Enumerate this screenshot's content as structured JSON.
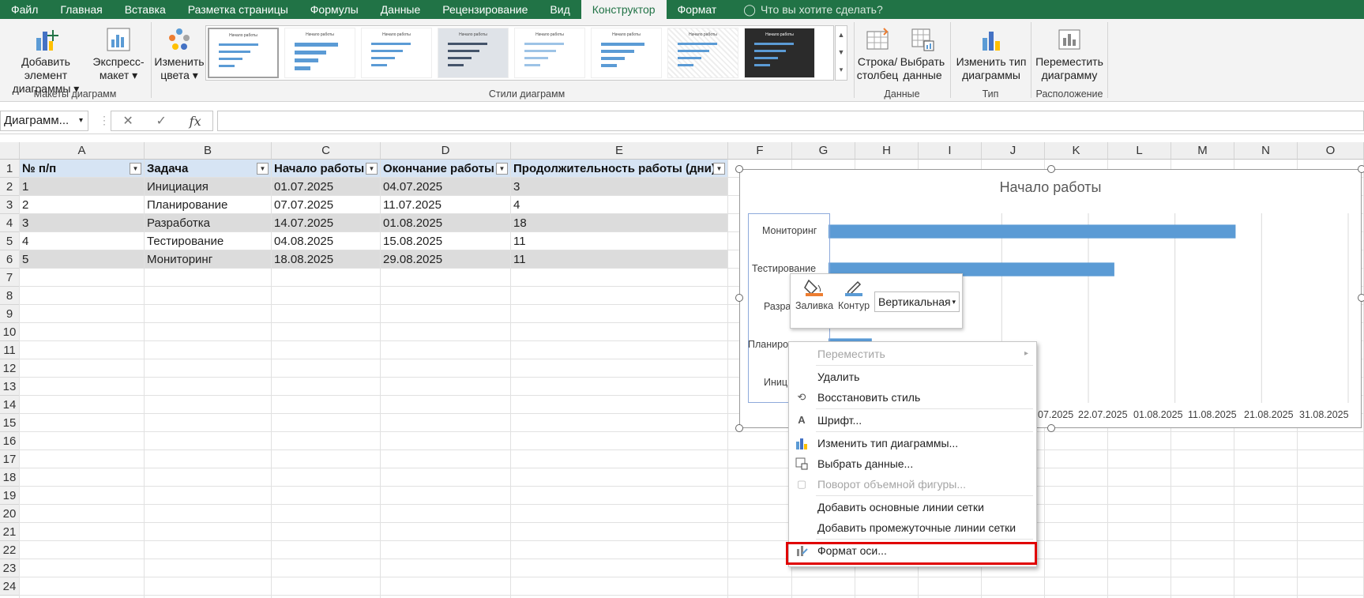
{
  "tabs": [
    "Файл",
    "Главная",
    "Вставка",
    "Разметка страницы",
    "Формулы",
    "Данные",
    "Рецензирование",
    "Вид",
    "Конструктор",
    "Формат"
  ],
  "active_tab": "Конструктор",
  "search_placeholder": "Что вы хотите сделать?",
  "ribbon": {
    "add_element": "Добавить элемент диаграммы",
    "express_layout": "Экспресс-макет",
    "change_colors": "Изменить цвета",
    "group_layouts": "Макеты диаграмм",
    "group_styles": "Стили диаграмм",
    "row_col": "Строка/ столбец",
    "select_data": "Выбрать данные",
    "group_data": "Данные",
    "change_type": "Изменить тип диаграммы",
    "group_type": "Тип",
    "move_chart": "Переместить диаграмму",
    "group_location": "Расположение",
    "style_thumb_title": "Начало работы"
  },
  "formula_bar": {
    "name_box": "Диаграмм...",
    "fx": "fx",
    "value": ""
  },
  "columns": [
    "A",
    "B",
    "C",
    "D",
    "E",
    "F",
    "G",
    "H",
    "I",
    "J",
    "K",
    "L",
    "M",
    "N",
    "O"
  ],
  "rows": [
    "1",
    "2",
    "3",
    "4",
    "5",
    "6",
    "7",
    "8",
    "9",
    "10",
    "11",
    "12",
    "13",
    "14",
    "15",
    "16",
    "17",
    "18",
    "19",
    "20",
    "21",
    "22",
    "23",
    "24"
  ],
  "table": {
    "headers": [
      "№ п/п",
      "Задача",
      "Начало работы",
      "Окончание работы",
      "Продолжительность работы (дни)"
    ],
    "rows": [
      [
        "1",
        "Инициация",
        "01.07.2025",
        "04.07.2025",
        "3"
      ],
      [
        "2",
        "Планирование",
        "07.07.2025",
        "11.07.2025",
        "4"
      ],
      [
        "3",
        "Разработка",
        "14.07.2025",
        "01.08.2025",
        "18"
      ],
      [
        "4",
        "Тестирование",
        "04.08.2025",
        "15.08.2025",
        "11"
      ],
      [
        "5",
        "Мониторинг",
        "18.08.2025",
        "29.08.2025",
        "11"
      ]
    ]
  },
  "chart": {
    "title": "Начало работы",
    "visible_y_labels": [
      "Мониторинг",
      "Тестирование",
      "Разра",
      "Планиро",
      "Иниц"
    ],
    "x_tick_labels": [
      "07.2025",
      "22.07.2025",
      "01.08.2025",
      "11.08.2025",
      "21.08.2025",
      "31.08.2025"
    ]
  },
  "chart_data": {
    "type": "bar",
    "title": "Начало работы",
    "categories": [
      "Инициация",
      "Планирование",
      "Разработка",
      "Тестирование",
      "Мониторинг"
    ],
    "values": [
      "01.07.2025",
      "07.07.2025",
      "14.07.2025",
      "04.08.2025",
      "18.08.2025"
    ],
    "x_tick_labels": [
      "22.07.2025",
      "01.08.2025",
      "11.08.2025",
      "21.08.2025",
      "31.08.2025"
    ],
    "bar_color": "#5b9bd5"
  },
  "mini_toolbar": {
    "fill": "Заливка",
    "outline": "Контур",
    "selector": "Вертикальная"
  },
  "context_menu": {
    "move": "Переместить",
    "delete": "Удалить",
    "reset_style": "Восстановить стиль",
    "font": "Шрифт...",
    "change_type": "Изменить тип диаграммы...",
    "select_data": "Выбрать данные...",
    "rotate_3d": "Поворот объемной фигуры...",
    "add_major_grid": "Добавить основные линии сетки",
    "add_minor_grid": "Добавить промежуточные линии сетки",
    "format_axis": "Формат оси..."
  },
  "colors": {
    "excel_green": "#217346",
    "table_header": "#d6e4f4",
    "band": "#dcdcdc",
    "bar": "#5b9bd5",
    "highlight": "#e00000",
    "fill_orange": "#ed7d31"
  }
}
